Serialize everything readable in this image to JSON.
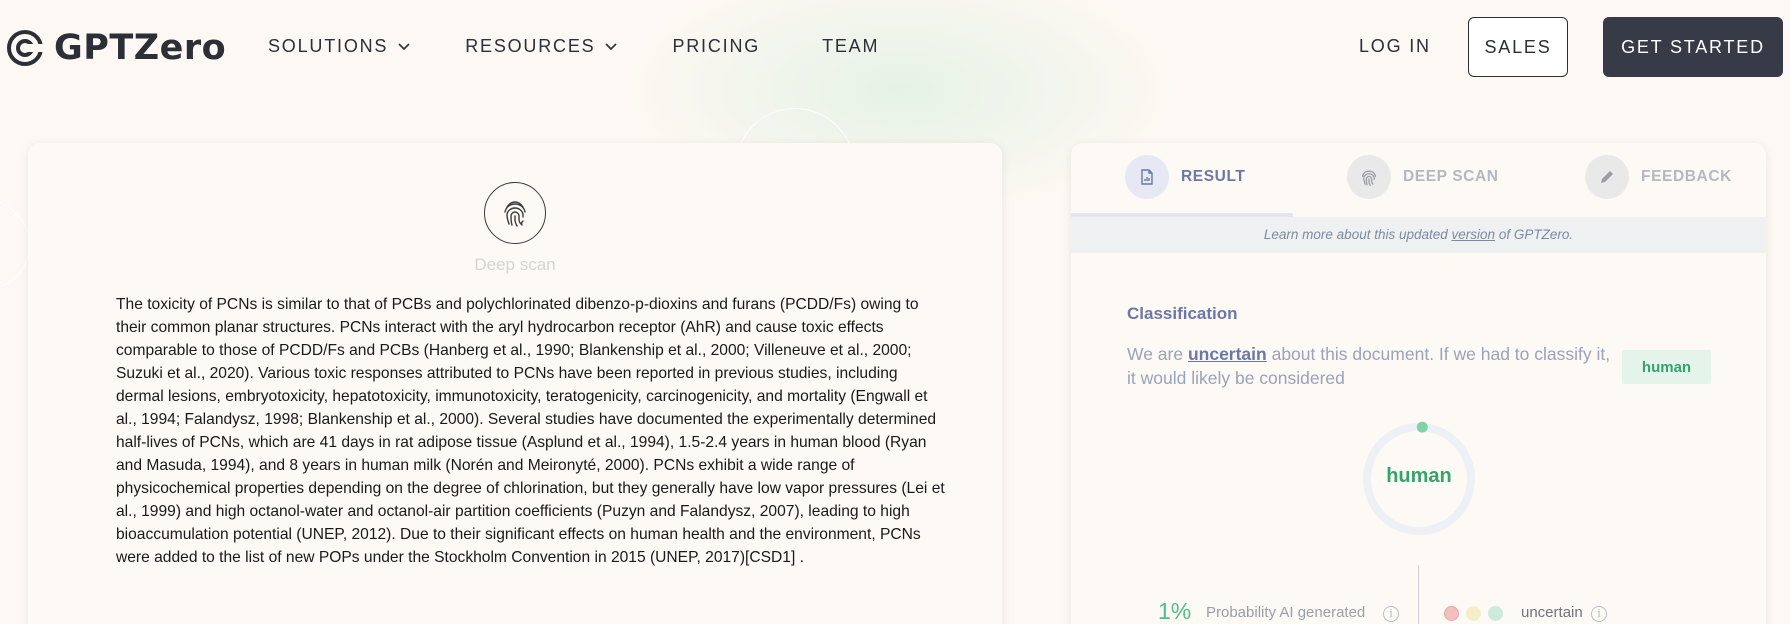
{
  "brand": {
    "name": "GPTZero"
  },
  "nav": {
    "items": [
      {
        "label": "SOLUTIONS",
        "dropdown": true
      },
      {
        "label": "RESOURCES",
        "dropdown": true
      },
      {
        "label": "PRICING",
        "dropdown": false
      },
      {
        "label": "TEAM",
        "dropdown": false
      }
    ],
    "login": "LOG IN",
    "sales": "SALES",
    "get_started": "GET STARTED"
  },
  "scan": {
    "label": "Deep scan",
    "icon": "fingerprint-icon",
    "text": "The toxicity of PCNs is similar to that of PCBs and polychlorinated dibenzo-p-dioxins and furans (PCDD/Fs) owing to their common planar structures. PCNs interact with the aryl hydrocarbon receptor (AhR) and cause toxic effects comparable to those of PCDD/Fs and PCBs (Hanberg et al., 1990; Blankenship et al., 2000; Villeneuve et al., 2000; Suzuki et al., 2020). Various toxic responses attributed to PCNs have been reported in previous studies, including dermal lesions, embryotoxicity, hepatotoxicity, immunotoxicity, teratogenicity, carcinogenicity, and mortality (Engwall et al., 1994; Falandysz, 1998; Blankenship et al., 2000). Several studies have documented the experimentally determined half-lives of PCNs, which are 41 days in rat adipose tissue (Asplund et al., 1994), 1.5-2.4 years in human blood (Ryan and Masuda, 1994), and 8 years in human milk (Norén and Meironyté, 2000). PCNs exhibit a wide range of physicochemical properties depending on the degree of chlorination, but they generally have low vapor pressures (Lei et al., 1999) and high octanol-water and octanol-air partition coefficients  (Puzyn and Falandysz, 2007), leading to high bioaccumulation potential (UNEP, 2012). Due to their significant effects on human health and the environment, PCNs were added to the list of new POPs under the Stockholm Convention in 2015 (UNEP, 2017)[CSD1] ."
  },
  "tabs": [
    {
      "label": "RESULT",
      "icon": "document-icon",
      "active": true
    },
    {
      "label": "DEEP SCAN",
      "icon": "fingerprint-icon",
      "active": false
    },
    {
      "label": "FEEDBACK",
      "icon": "pencil-icon",
      "active": false
    }
  ],
  "info_bar": {
    "before": "Learn more about this updated ",
    "link": "version",
    "after": " of GPTZero."
  },
  "classification": {
    "title": "Classification",
    "pre": "We are ",
    "strong": "uncertain",
    "post": " about this document. If we had to classify it, it would likely be considered",
    "badge": "human",
    "gauge_label": "human",
    "gauge_fraction": 0.01
  },
  "probability": {
    "value": "1%",
    "label": "Probability AI generated",
    "confidence": "uncertain"
  },
  "colors": {
    "accent": "#6b77a8",
    "human_green": "#36a36d",
    "dot_red": "#f2c0c0",
    "dot_yellow": "#f5efc9",
    "dot_green": "#cdebdc"
  }
}
